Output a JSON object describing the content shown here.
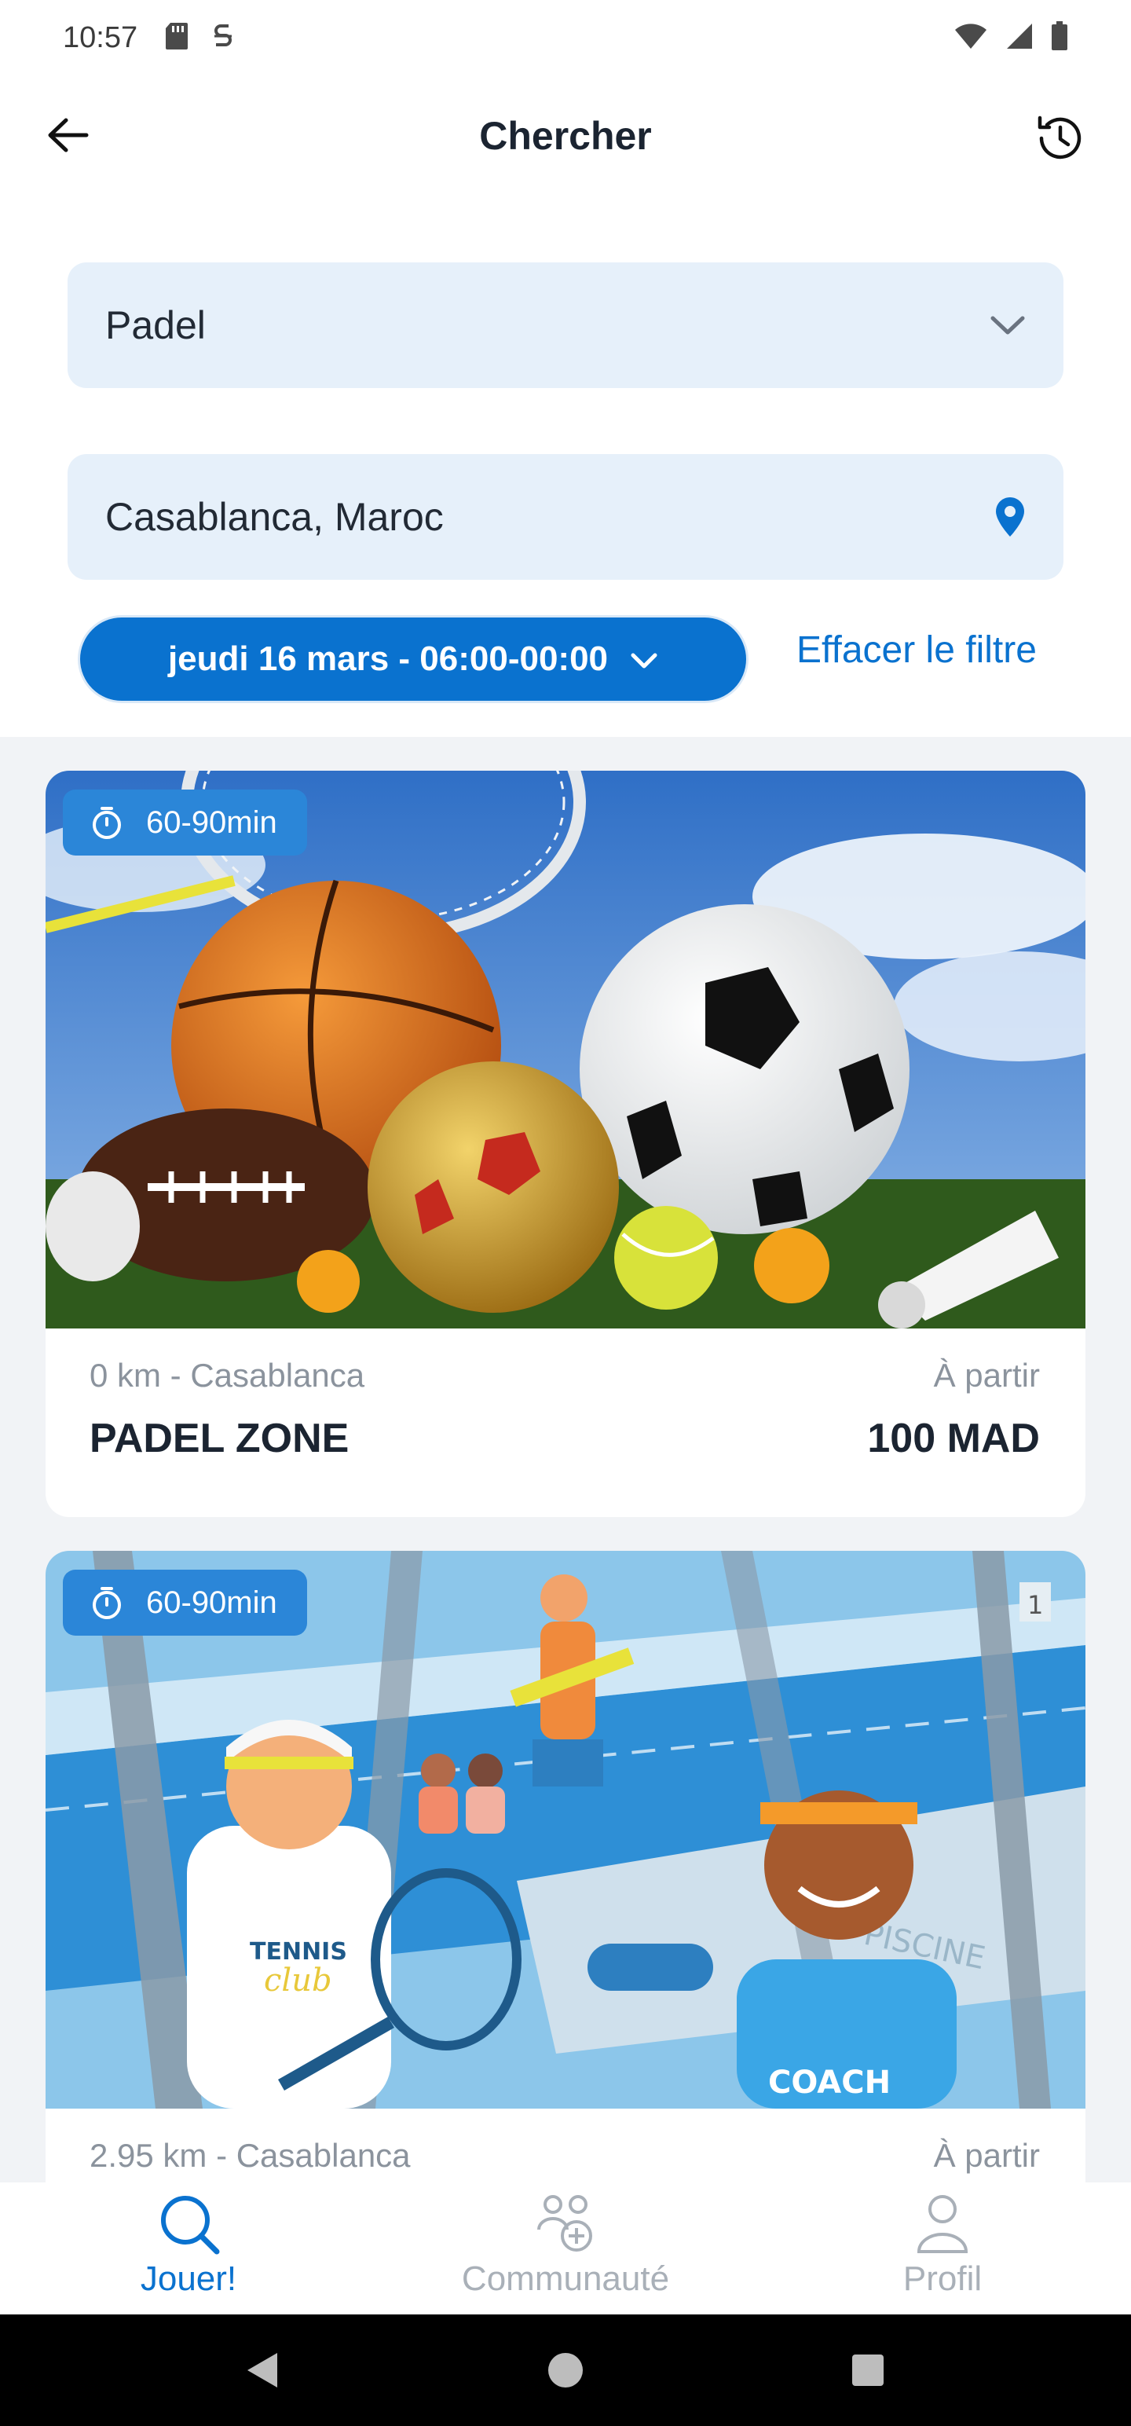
{
  "status_bar": {
    "time": "10:57"
  },
  "app_bar": {
    "title": "Chercher"
  },
  "filters": {
    "sport": "Padel",
    "location": "Casablanca, Maroc",
    "date": "jeudi 16 mars - 06:00-00:00",
    "clear_label": "Effacer le filtre"
  },
  "results": [
    {
      "duration": "60-90min",
      "distance": "0 km - Casablanca",
      "from_label": "À partir",
      "name": "PADEL ZONE",
      "price": "100 MAD"
    },
    {
      "duration": "60-90min",
      "distance": "2.95 km - Casablanca",
      "from_label": "À partir",
      "name": "",
      "price": ""
    }
  ],
  "image_text": {
    "tennis": "TENNIS",
    "club": "club",
    "coach": "COACH",
    "piscine": "PISCINE",
    "lane": "1"
  },
  "bottom_nav": [
    {
      "label": "Jouer!",
      "icon": "search-icon",
      "active": true
    },
    {
      "label": "Communauté",
      "icon": "community-icon",
      "active": false
    },
    {
      "label": "Profil",
      "icon": "profile-icon",
      "active": false
    }
  ],
  "colors": {
    "accent": "#0a72cf",
    "field_bg": "#e6f0fa",
    "badge": "#2b86d8",
    "list_bg": "#f1f3f6"
  }
}
